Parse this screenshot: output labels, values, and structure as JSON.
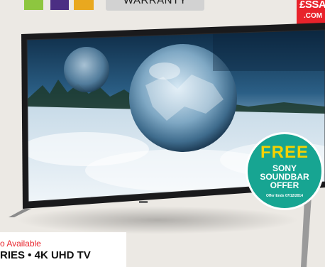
{
  "header": {
    "warranty_label": "WARRANTY",
    "swatch_colors": [
      "#8dc63f",
      "#4b2e83",
      "#e9a81f"
    ]
  },
  "brand": {
    "name": "£SSAV",
    "domain": ".COM",
    "color": "#e8232b"
  },
  "offer": {
    "headline": "FREE",
    "line1": "SONY",
    "line2": "SOUNDBAR",
    "line3": "OFFER",
    "ends": "Offer Ends 07/12/2014",
    "color": "#17a592"
  },
  "product": {
    "availability": "o Available",
    "title": "RIES • 4K UHD TV"
  }
}
